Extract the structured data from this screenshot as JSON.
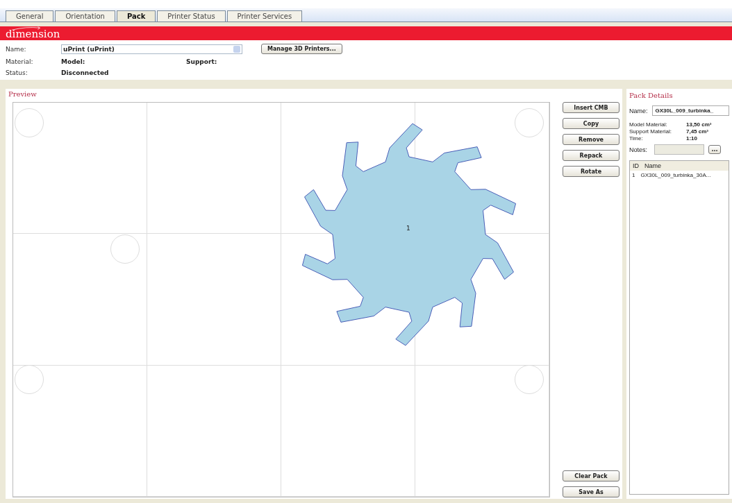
{
  "tabs": [
    {
      "label": "General",
      "selected": false
    },
    {
      "label": "Orientation",
      "selected": false
    },
    {
      "label": "Pack",
      "selected": true
    },
    {
      "label": "Printer Status",
      "selected": false
    },
    {
      "label": "Printer Services",
      "selected": false
    }
  ],
  "brand": "dimension",
  "printer": {
    "name_label": "Name:",
    "name_value": "uPrint  (uPrint)",
    "manage_button": "Manage 3D Printers...",
    "material_label": "Material:",
    "model_label": "Model:",
    "support_label": "Support:",
    "status_label": "Status:",
    "status_value": "Disconnected"
  },
  "preview": {
    "title": "Preview",
    "part_label": "1"
  },
  "actions": [
    "Insert CMB",
    "Copy",
    "Remove",
    "Repack",
    "Rotate"
  ],
  "bottom_actions": [
    "Clear Pack",
    "Save As"
  ],
  "pack_details": {
    "title": "Pack Details",
    "name_label": "Name:",
    "name_value": "GX30L_009_turbinka_",
    "stats": [
      {
        "label": "Model Material:",
        "value": "13,50 cm³"
      },
      {
        "label": "Support Material:",
        "value": "7,45 cm³"
      },
      {
        "label": "Time:",
        "value": "1:10"
      }
    ],
    "notes_label": "Notes:",
    "notes_button": "...",
    "table": {
      "columns": [
        "ID",
        "Name"
      ],
      "rows": [
        [
          "1",
          "GX30L_009_turbinka_30A..."
        ]
      ]
    }
  }
}
